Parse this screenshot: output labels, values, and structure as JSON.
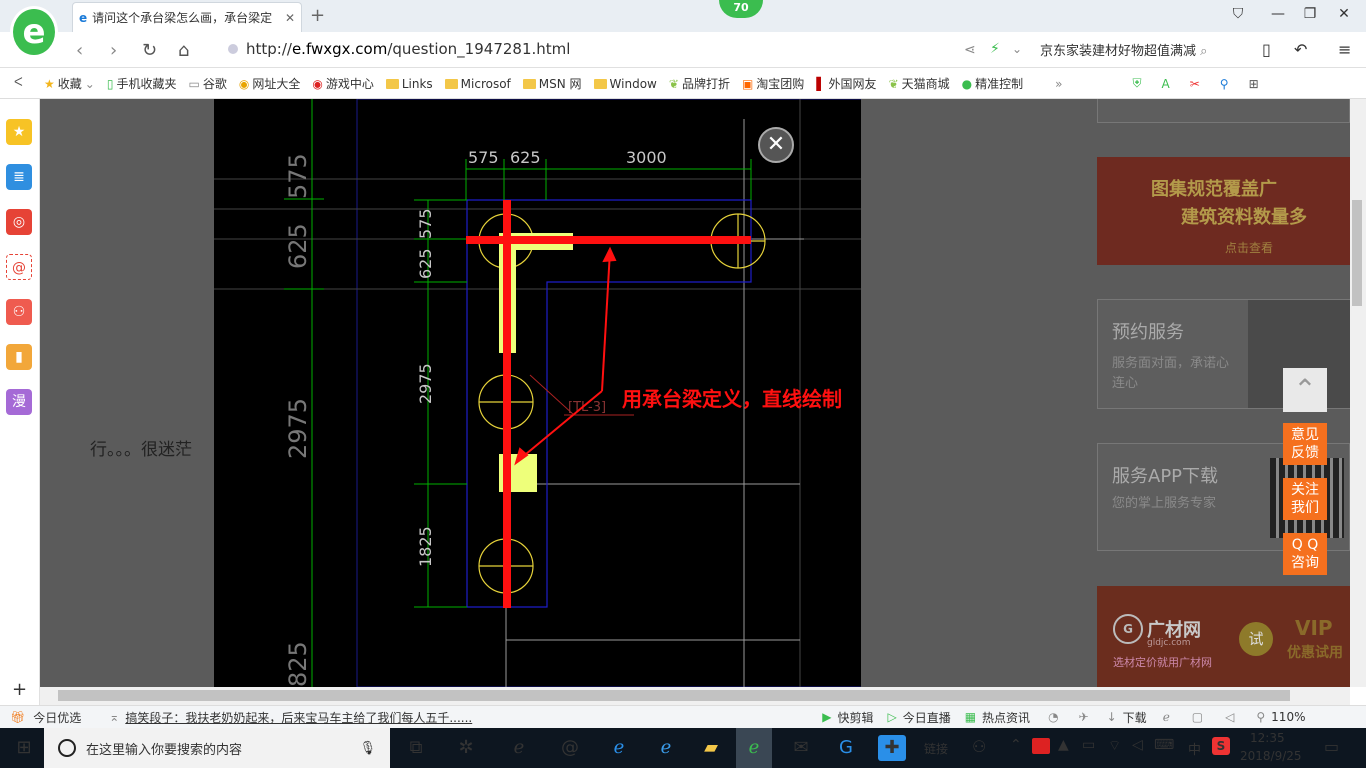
{
  "tabs": [
    {
      "title": "请问这个承台梁怎么画，承台梁定",
      "close": "✕"
    }
  ],
  "badge": "70",
  "url": {
    "prefix": "http://",
    "domain": "e.fwxgx.com",
    "path": "/question_1947281.html"
  },
  "search": {
    "text": "京东家装建材好物超值满减"
  },
  "bookmarks": [
    "收藏",
    "手机收藏夹",
    "谷歌",
    "网址大全",
    "游戏中心",
    "Links",
    "Microsof",
    "MSN 网",
    "Window",
    "品牌打折",
    "淘宝团购",
    "外国网友",
    "天猫商城",
    "精准控制"
  ],
  "main": {
    "partial_text": "行。。。很迷茫"
  },
  "cad": {
    "dims_top": [
      "575",
      "625",
      "3000"
    ],
    "dims_left": [
      "625",
      "575",
      "2975",
      "1825"
    ],
    "dims_far": [
      "625",
      "575",
      "2975",
      "825"
    ],
    "tag": "[TL-3]",
    "annotation": "用承台梁定义，直线绘制"
  },
  "right": {
    "ad1_line1": "图集规范覆盖广",
    "ad1_line2": "建筑资料数量多",
    "ad1_btn": "点击查看",
    "service_title": "预约服务",
    "service_desc": "服务面对面，承诺心连心",
    "app_title": "服务APP下载",
    "app_desc": "您的掌上服务专家",
    "ad2_brand": "广材网",
    "ad2_sub": "gldjc.com",
    "ad2_slogan": "选材定价就用广材网",
    "ad2_vip": "VIP",
    "ad2_vipsub": "优惠试用",
    "ad2_try": "试"
  },
  "float": {
    "feedback": "意见反馈",
    "follow": "关注我们",
    "qq": "Q Q 咨询"
  },
  "statusbar": {
    "today": "今日优选",
    "news": "搞笑段子：我扶老奶奶起来，后来宝马车主给了我们每人五千......",
    "clip": "快剪辑",
    "live": "今日直播",
    "hot": "热点资讯",
    "download": "下载",
    "zoom": "110%"
  },
  "taskbar": {
    "search_placeholder": "在这里输入你要搜索的内容",
    "link": "链接",
    "ime": "中",
    "time": "12:35",
    "date": "2018/9/25"
  },
  "colors": {
    "accent": "#3bbd4f",
    "beam": "#ff1010",
    "column": "#eeff7a",
    "cad_bg": "#000000",
    "float_btn": "#f5701e"
  }
}
